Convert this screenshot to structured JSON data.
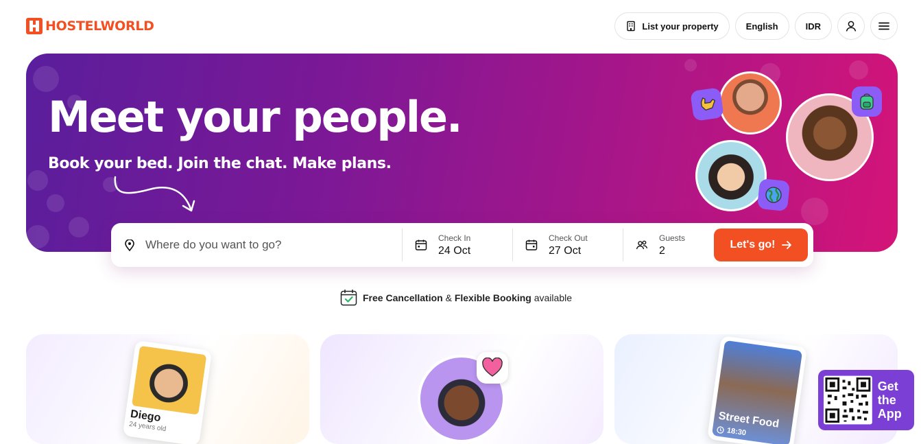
{
  "brand": {
    "name": "HOSTELWORLD"
  },
  "header": {
    "list_property": "List your property",
    "language": "English",
    "currency": "IDR"
  },
  "hero": {
    "title": "Meet your people.",
    "subtitle": "Book your bed. Join the chat. Make plans."
  },
  "search": {
    "placeholder": "Where do you want to go?",
    "check_in_label": "Check In",
    "check_in_value": "24 Oct",
    "check_out_label": "Check Out",
    "check_out_value": "27 Oct",
    "guests_label": "Guests",
    "guests_value": "2",
    "submit_label": "Let's go!"
  },
  "booking_note": {
    "part1": "Free Cancellation",
    "part2": " & ",
    "part3": "Flexible Booking",
    "part4": " available"
  },
  "cards": [
    {
      "photo_caption": "Diego",
      "photo_subcaption": "24 years old"
    },
    {
      "photo_caption": ""
    },
    {
      "photo_caption": "Street Food",
      "photo_subcaption": "18:30"
    }
  ],
  "app_promo": {
    "text": "Get the App"
  },
  "colors": {
    "brand": "#f25022",
    "hero_start": "#5a1e9c",
    "hero_end": "#d41478",
    "promo": "#7b3fd6"
  }
}
